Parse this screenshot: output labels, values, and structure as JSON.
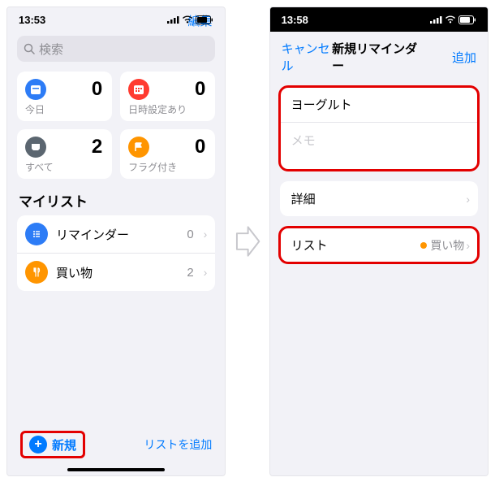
{
  "left": {
    "statusTime": "13:53",
    "editBtn": "編集",
    "searchPlaceholder": "検索",
    "cards": [
      {
        "label": "今日",
        "count": "0",
        "color": "#2d7cf6"
      },
      {
        "label": "日時設定あり",
        "count": "0",
        "color": "#ff3b30"
      },
      {
        "label": "すべて",
        "count": "2",
        "color": "#5b6670"
      },
      {
        "label": "フラグ付き",
        "count": "0",
        "color": "#ff9500"
      }
    ],
    "myListsTitle": "マイリスト",
    "lists": [
      {
        "label": "リマインダー",
        "count": "0",
        "color": "#2d7cf6"
      },
      {
        "label": "買い物",
        "count": "2",
        "color": "#ff9500"
      }
    ],
    "newBtn": "新規",
    "addListBtn": "リストを追加"
  },
  "right": {
    "statusTime": "13:58",
    "cancel": "キャンセル",
    "title": "新規リマインダー",
    "add": "追加",
    "inputTitle": "ヨーグルト",
    "memoPlaceholder": "メモ",
    "detailLabel": "詳細",
    "listLabel": "リスト",
    "listValue": "買い物"
  }
}
